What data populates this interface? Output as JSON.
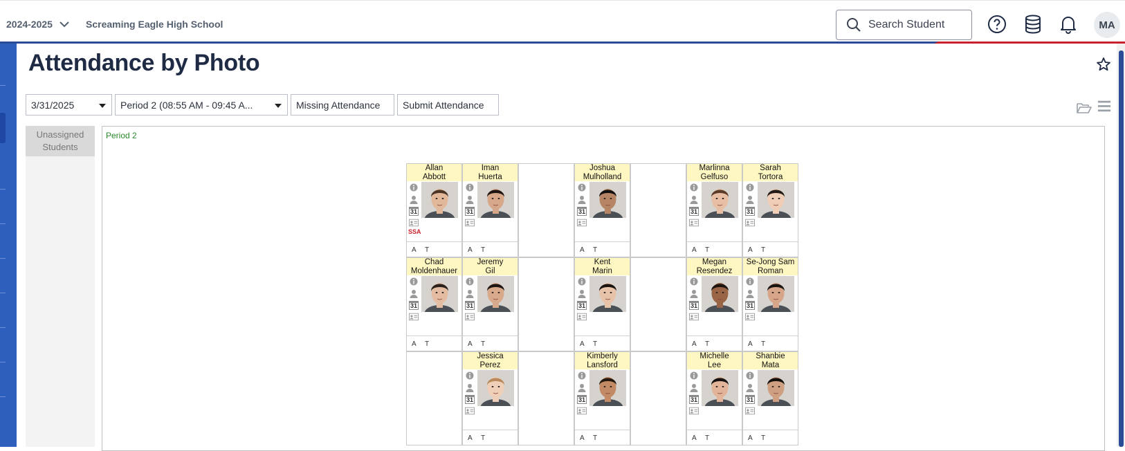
{
  "topbar": {
    "year": "2024-2025",
    "school": "Screaming Eagle High School",
    "search_placeholder": "Search Student",
    "avatar_initials": "MA"
  },
  "page": {
    "title": "Attendance by Photo"
  },
  "toolbar": {
    "date": "3/31/2025",
    "period": "Period 2 (08:55 AM - 09:45 A...",
    "missing_attendance": "Missing Attendance",
    "submit_attendance": "Submit Attendance"
  },
  "unassigned_label": "Unassigned Students",
  "period_label": "Period 2",
  "attendance_codes": {
    "absent": "A",
    "tardy": "T"
  },
  "calendar_glyph": "31",
  "students": [
    {
      "id": "allan",
      "first": "Allan",
      "last": "Abbott",
      "tag": "SSA",
      "skin": "#e2b89a",
      "hair": "#4a3424"
    },
    {
      "id": "iman",
      "first": "Iman",
      "last": "Huerta",
      "tag": "",
      "skin": "#d7a78a",
      "hair": "#1e1410"
    },
    {
      "id": "joshua",
      "first": "Joshua",
      "last": "Mulholland",
      "tag": "",
      "skin": "#b68565",
      "hair": "#141010"
    },
    {
      "id": "marlinna",
      "first": "Marlinna",
      "last": "Gelfuso",
      "tag": "",
      "skin": "#e6bfa5",
      "hair": "#5a3b28"
    },
    {
      "id": "sarah",
      "first": "Sarah",
      "last": "Tortora",
      "tag": "",
      "skin": "#efcdb6",
      "hair": "#231a15"
    },
    {
      "id": "chad",
      "first": "Chad",
      "last": "Moldenhauer",
      "tag": "",
      "skin": "#e3bca2",
      "hair": "#2b211c"
    },
    {
      "id": "jeremy",
      "first": "Jeremy",
      "last": "Gil",
      "tag": "",
      "skin": "#d9a98c",
      "hair": "#1e1612"
    },
    {
      "id": "kent",
      "first": "Kent",
      "last": "Marin",
      "tag": "",
      "skin": "#e7c3aa",
      "hair": "#1a1411"
    },
    {
      "id": "megan",
      "first": "Megan",
      "last": "Resendez",
      "tag": "",
      "skin": "#9a6446",
      "hair": "#1d130f"
    },
    {
      "id": "sejong",
      "first": "Se-Jong Sam",
      "last": "Roman",
      "tag": "",
      "skin": "#d6a58a",
      "hair": "#1b1512"
    },
    {
      "id": "jessica",
      "first": "Jessica",
      "last": "Perez",
      "tag": "",
      "skin": "#f0cfb8",
      "hair": "#b98a5c"
    },
    {
      "id": "kimberly",
      "first": "Kimberly",
      "last": "Lansford",
      "tag": "",
      "skin": "#c28b66",
      "hair": "#24180f"
    },
    {
      "id": "michelle",
      "first": "Michelle",
      "last": "Lee",
      "tag": "",
      "skin": "#e2b59a",
      "hair": "#161211"
    },
    {
      "id": "shanbie",
      "first": "Shanbie",
      "last": "Mata",
      "tag": "",
      "skin": "#cf9f82",
      "hair": "#120e0c"
    }
  ]
}
